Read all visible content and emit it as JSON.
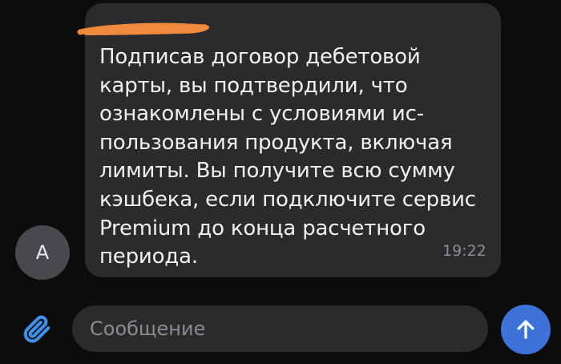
{
  "chat": {
    "sender_initial": "A",
    "message": {
      "text": "Подписав договор дебетовой\nкарты, вы подтвердили, что\nознакомлены с условиями ис-\nпользования продукта, включая\nлимиты. Вы получите всю сумму\nкэшбека, если подключите сервис\nPremium до конца расчетного\nпериода.",
      "time": "19:22"
    }
  },
  "composer": {
    "placeholder": "Сообщение"
  },
  "colors": {
    "background": "#0c0c0d",
    "bubble": "#2b2b2d",
    "accent": "#3d73d9",
    "redaction": "#f08a3c"
  },
  "icons": {
    "attach": "paperclip-icon",
    "send": "arrow-up-icon"
  }
}
